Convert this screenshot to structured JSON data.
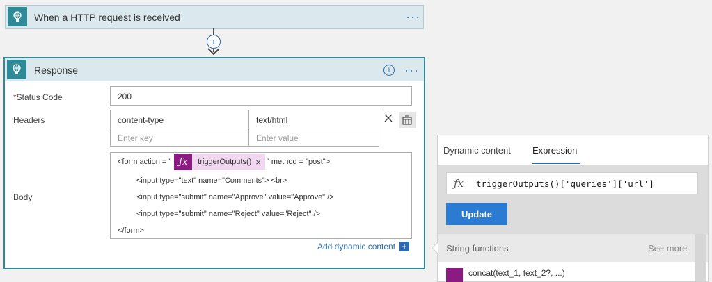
{
  "trigger": {
    "title": "When a HTTP request is received",
    "more": "···"
  },
  "add_step": "+",
  "response": {
    "title": "Response",
    "info_icon": "i",
    "more": "···",
    "status_label": "Status Code",
    "required_mark": "*",
    "status_value": "200",
    "headers_label": "Headers",
    "header_key": "content-type",
    "header_value": "text/html",
    "key_placeholder": "Enter key",
    "value_placeholder": "Enter value",
    "body_label": "Body",
    "body_line1_pre": "<form action = \"",
    "token_label": "triggerOutputs()",
    "token_close": "×",
    "body_line1_post": "\" method = \"post\">",
    "body_line2": "<input type=\"text\" name=\"Comments\"> <br>",
    "body_line3": "<input type=\"submit\" name=\"Approve\" value=\"Approve\" />",
    "body_line4": "<input type=\"submit\" name=\"Reject\" value=\"Reject\" />",
    "body_line5": "</form>",
    "add_dynamic": "Add dynamic content",
    "add_dynamic_icon": "+"
  },
  "panel": {
    "tab_dynamic": "Dynamic content",
    "tab_expression": "Expression",
    "expression": "triggerOutputs()['queries']['url']",
    "update_label": "Update",
    "section_title": "String functions",
    "see_more": "See more",
    "first_item": "concat(text_1, text_2?, ...)"
  },
  "colors": {
    "accent": "#2f8a97",
    "token_fx": "#8b1b83",
    "token_bg": "#f2d7f0",
    "update_btn": "#2b7bd3"
  }
}
